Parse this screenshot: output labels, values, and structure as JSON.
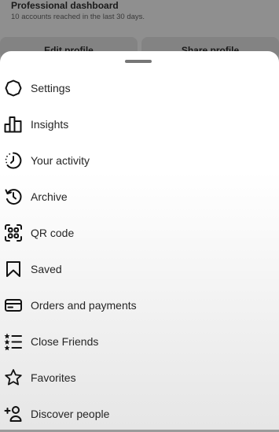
{
  "dashboard": {
    "title": "Professional dashboard",
    "subtitle": "10 accounts reached in the last 30 days."
  },
  "profile_buttons": {
    "edit": "Edit profile",
    "share": "Share profile"
  },
  "menu": {
    "items": [
      {
        "label": "Settings",
        "icon": "settings-icon"
      },
      {
        "label": "Insights",
        "icon": "insights-icon"
      },
      {
        "label": "Your activity",
        "icon": "activity-icon"
      },
      {
        "label": "Archive",
        "icon": "archive-icon"
      },
      {
        "label": "QR code",
        "icon": "qr-code-icon"
      },
      {
        "label": "Saved",
        "icon": "bookmark-icon"
      },
      {
        "label": "Orders and payments",
        "icon": "card-icon"
      },
      {
        "label": "Close Friends",
        "icon": "close-friends-icon"
      },
      {
        "label": "Favorites",
        "icon": "star-icon"
      },
      {
        "label": "Discover people",
        "icon": "add-person-icon"
      }
    ]
  }
}
